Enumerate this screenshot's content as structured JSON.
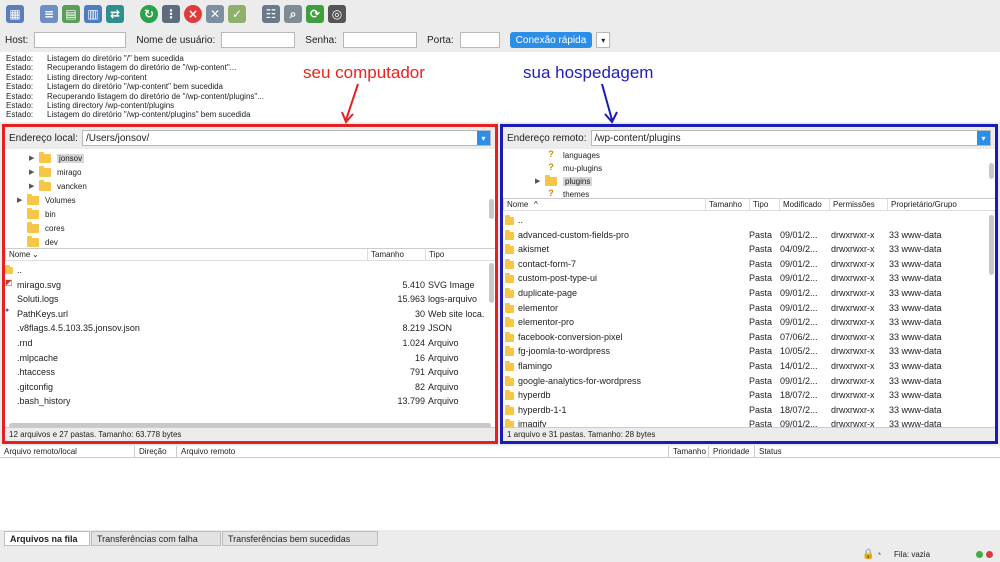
{
  "toolbar": {
    "icons": [
      "site-manager-icon",
      "toggle-log-icon",
      "toggle-local-tree-icon",
      "toggle-remote-tree-icon",
      "toggle-queue-icon",
      "refresh-icon",
      "process-queue-icon",
      "cancel-icon",
      "disconnect-icon",
      "reconnect-icon",
      "directory-filter-icon",
      "compare-icon",
      "sync-browse-icon",
      "search-icon"
    ]
  },
  "quickconnect": {
    "host_label": "Host:",
    "user_label": "Nome de usuário:",
    "pass_label": "Senha:",
    "port_label": "Porta:",
    "host_value": "",
    "user_value": "",
    "pass_value": "",
    "port_value": "",
    "button_label": "Conexão rápida",
    "dropdown_glyph": "▾"
  },
  "log": [
    {
      "status": "Estado:",
      "msg": "Listagem do diretório \"/\" bem sucedida"
    },
    {
      "status": "Estado:",
      "msg": "Recuperando listagem do diretório de \"/wp-content\"..."
    },
    {
      "status": "Estado:",
      "msg": "Listing directory /wp-content"
    },
    {
      "status": "Estado:",
      "msg": "Listagem do diretório \"/wp-content\" bem sucedida"
    },
    {
      "status": "Estado:",
      "msg": "Recuperando listagem do diretório de \"/wp-content/plugins\"..."
    },
    {
      "status": "Estado:",
      "msg": "Listing directory /wp-content/plugins"
    },
    {
      "status": "Estado:",
      "msg": "Listagem do diretório \"/wp-content/plugins\" bem sucedida"
    }
  ],
  "annotations": {
    "local": "seu computador",
    "remote": "sua hospedagem"
  },
  "colors": {
    "local_border": "#e32121",
    "remote_border": "#1a1ab5",
    "accent": "#2b8fe8",
    "folder": "#f7c646"
  },
  "local": {
    "address_label": "Endereço local:",
    "address_value": "/Users/jonsov/",
    "tree": [
      {
        "name": "jonsov",
        "indent": 2,
        "expander": "▶",
        "selected": true
      },
      {
        "name": "mirago",
        "indent": 2,
        "expander": "▶",
        "selected": false
      },
      {
        "name": "vancken",
        "indent": 2,
        "expander": "▶",
        "selected": false
      },
      {
        "name": "Volumes",
        "indent": 1,
        "expander": "▶",
        "selected": false
      },
      {
        "name": "bin",
        "indent": 1,
        "expander": "",
        "selected": false
      },
      {
        "name": "cores",
        "indent": 1,
        "expander": "",
        "selected": false
      },
      {
        "name": "dev",
        "indent": 1,
        "expander": "",
        "selected": false
      }
    ],
    "columns": [
      "Nome",
      "Tamanho",
      "Tipo"
    ],
    "sort_glyph": "⌄",
    "files": [
      {
        "name": "..",
        "size": "",
        "type": "",
        "icon": "folder"
      },
      {
        "name": "mirago.svg",
        "size": "5.410",
        "type": "SVG Image",
        "icon": "svg"
      },
      {
        "name": "Soluti.logs",
        "size": "15.963",
        "type": "logs-arquivo",
        "icon": "file"
      },
      {
        "name": "PathKeys.url",
        "size": "30",
        "type": "Web site loca.",
        "icon": "url"
      },
      {
        "name": ".v8flags.4.5.103.35.jonsov.json",
        "size": "8.219",
        "type": "JSON",
        "icon": "file"
      },
      {
        "name": ".rnd",
        "size": "1.024",
        "type": "Arquivo",
        "icon": "file"
      },
      {
        "name": ".mlpcache",
        "size": "16",
        "type": "Arquivo",
        "icon": "file"
      },
      {
        "name": ".htaccess",
        "size": "791",
        "type": "Arquivo",
        "icon": "file"
      },
      {
        "name": ".gitconfig",
        "size": "82",
        "type": "Arquivo",
        "icon": "file"
      },
      {
        "name": ".bash_history",
        "size": "13.799",
        "type": "Arquivo",
        "icon": "file"
      }
    ],
    "status": "12 arquivos e 27 pastas. Tamanho: 63.778 bytes"
  },
  "remote": {
    "address_label": "Endereço remoto:",
    "address_value": "/wp-content/plugins",
    "tree": [
      {
        "name": "languages",
        "indent": 2,
        "expander": "",
        "selected": false,
        "unknown": true
      },
      {
        "name": "mu-plugins",
        "indent": 2,
        "expander": "",
        "selected": false,
        "unknown": true
      },
      {
        "name": "plugins",
        "indent": 2,
        "expander": "▶",
        "selected": true,
        "unknown": false
      },
      {
        "name": "themes",
        "indent": 2,
        "expander": "",
        "selected": false,
        "unknown": true
      }
    ],
    "columns": [
      "Nome",
      "Tamanho",
      "Tipo",
      "Modificado",
      "Permissões",
      "Proprietário/Grupo"
    ],
    "sort_glyph": "^",
    "files": [
      {
        "name": "..",
        "type": "",
        "modified": "",
        "perms": "",
        "owner": ""
      },
      {
        "name": "advanced-custom-fields-pro",
        "type": "Pasta",
        "modified": "09/01/2...",
        "perms": "drwxrwxr-x",
        "owner": "33 www-data"
      },
      {
        "name": "akismet",
        "type": "Pasta",
        "modified": "04/09/2...",
        "perms": "drwxrwxr-x",
        "owner": "33 www-data"
      },
      {
        "name": "contact-form-7",
        "type": "Pasta",
        "modified": "09/01/2...",
        "perms": "drwxrwxr-x",
        "owner": "33 www-data"
      },
      {
        "name": "custom-post-type-ui",
        "type": "Pasta",
        "modified": "09/01/2...",
        "perms": "drwxrwxr-x",
        "owner": "33 www-data"
      },
      {
        "name": "duplicate-page",
        "type": "Pasta",
        "modified": "09/01/2...",
        "perms": "drwxrwxr-x",
        "owner": "33 www-data"
      },
      {
        "name": "elementor",
        "type": "Pasta",
        "modified": "09/01/2...",
        "perms": "drwxrwxr-x",
        "owner": "33 www-data"
      },
      {
        "name": "elementor-pro",
        "type": "Pasta",
        "modified": "09/01/2...",
        "perms": "drwxrwxr-x",
        "owner": "33 www-data"
      },
      {
        "name": "facebook-conversion-pixel",
        "type": "Pasta",
        "modified": "07/06/2...",
        "perms": "drwxrwxr-x",
        "owner": "33 www-data"
      },
      {
        "name": "fg-joomla-to-wordpress",
        "type": "Pasta",
        "modified": "10/05/2...",
        "perms": "drwxrwxr-x",
        "owner": "33 www-data"
      },
      {
        "name": "flamingo",
        "type": "Pasta",
        "modified": "14/01/2...",
        "perms": "drwxrwxr-x",
        "owner": "33 www-data"
      },
      {
        "name": "google-analytics-for-wordpress",
        "type": "Pasta",
        "modified": "09/01/2...",
        "perms": "drwxrwxr-x",
        "owner": "33 www-data"
      },
      {
        "name": "hyperdb",
        "type": "Pasta",
        "modified": "18/07/2...",
        "perms": "drwxrwxr-x",
        "owner": "33 www-data"
      },
      {
        "name": "hyperdb-1-1",
        "type": "Pasta",
        "modified": "18/07/2...",
        "perms": "drwxrwxr-x",
        "owner": "33 www-data"
      },
      {
        "name": "imagify",
        "type": "Pasta",
        "modified": "09/01/2...",
        "perms": "drwxrwxr-x",
        "owner": "33 www-data"
      }
    ],
    "status": "1 arquivo e 31 pastas. Tamanho: 28 bytes"
  },
  "queue": {
    "columns": [
      "Arquivo remoto/local",
      "Direção",
      "Arquivo remoto",
      "Tamanho",
      "Prioridade",
      "Status"
    ]
  },
  "tabs": [
    "Arquivos na fila",
    "Transferências com falha",
    "Transferências bem sucedidas"
  ],
  "statusbar": {
    "queue_text": "Fila: vazia"
  }
}
